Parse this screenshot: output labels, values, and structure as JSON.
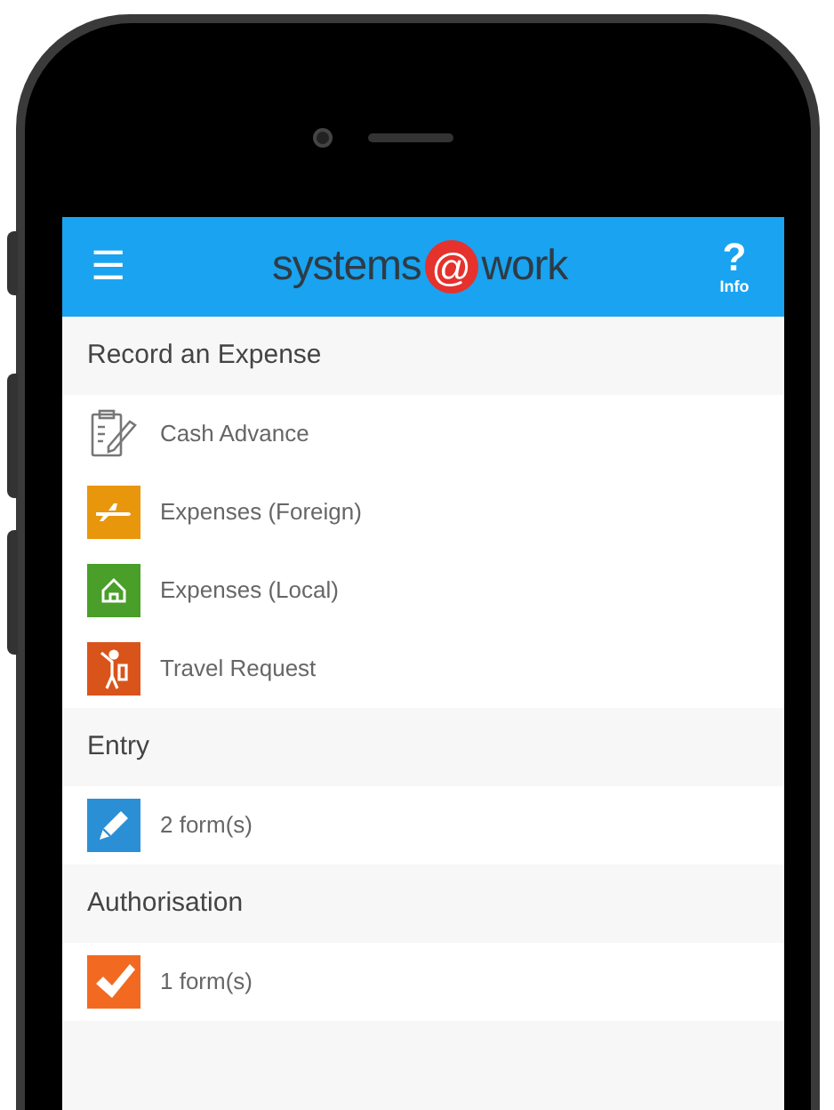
{
  "header": {
    "menu_icon": "☰",
    "logo": {
      "left": "systems",
      "mark": "@",
      "right": "work"
    },
    "info": {
      "glyph": "?",
      "label": "Info"
    }
  },
  "sections": [
    {
      "title": "Record an Expense",
      "items": [
        {
          "label": "Cash Advance",
          "kind": "clipboard"
        },
        {
          "label": "Expenses (Foreign)",
          "kind": "plane",
          "color": "#e8960c"
        },
        {
          "label": "Expenses (Local)",
          "kind": "home",
          "color": "#4a9e2a"
        },
        {
          "label": "Travel Request",
          "kind": "traveller",
          "color": "#d9541a"
        }
      ]
    },
    {
      "title": "Entry",
      "items": [
        {
          "label": "2 form(s)",
          "kind": "pencil",
          "color": "#2b8fd6"
        }
      ]
    },
    {
      "title": "Authorisation",
      "items": [
        {
          "label": "1 form(s)",
          "kind": "check",
          "color": "#f26a21"
        }
      ]
    }
  ]
}
